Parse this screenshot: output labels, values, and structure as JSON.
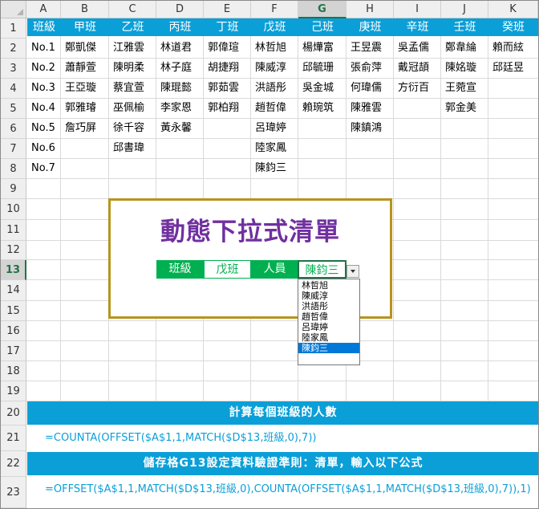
{
  "columns": [
    "A",
    "B",
    "C",
    "D",
    "E",
    "F",
    "G",
    "H",
    "I",
    "J",
    "K"
  ],
  "rows": [
    "1",
    "2",
    "3",
    "4",
    "5",
    "6",
    "7",
    "8",
    "9",
    "10",
    "11",
    "12",
    "13",
    "14",
    "15",
    "16",
    "17",
    "18",
    "19",
    "20",
    "21",
    "22",
    "23"
  ],
  "header": [
    "班級",
    "甲班",
    "乙班",
    "丙班",
    "丁班",
    "戊班",
    "己班",
    "庚班",
    "辛班",
    "壬班",
    "癸班"
  ],
  "data_rows": [
    [
      "No.1",
      "鄭凱傑",
      "江雅雲",
      "林道君",
      "郭偉瑄",
      "林哲旭",
      "楊燁富",
      "王昱震",
      "吳孟儒",
      "鄭韋綸",
      "賴而絃"
    ],
    [
      "No.2",
      "蕭靜萱",
      "陳明柔",
      "林子庭",
      "胡捷翔",
      "陳威淳",
      "邱毓珊",
      "張俞萍",
      "戴冠頡",
      "陳姳璇",
      "邱廷昱"
    ],
    [
      "No.3",
      "王亞璇",
      "蔡宜萱",
      "陳琨懿",
      "郭茹雲",
      "洪語彤",
      "吳金城",
      "何瑋儒",
      "方衍百",
      "王菀宣",
      ""
    ],
    [
      "No.4",
      "郭雅璿",
      "巫佩榆",
      "李家恩",
      "郭柏翔",
      "趙哲偉",
      "賴琬筑",
      "陳雅雲",
      "",
      "郭金美",
      ""
    ],
    [
      "No.5",
      "詹巧屏",
      "徐千容",
      "黃永馨",
      "",
      "呂瑋婷",
      "",
      "陳鎮鴻",
      "",
      "",
      ""
    ],
    [
      "No.6",
      "",
      "邱書瑋",
      "",
      "",
      "陸家鳳",
      "",
      "",
      "",
      "",
      ""
    ],
    [
      "No.7",
      "",
      "",
      "",
      "",
      "陳鈞三",
      "",
      "",
      "",
      "",
      ""
    ]
  ],
  "panel": {
    "title": "動態下拉式清單",
    "class_label": "班級",
    "class_value": "戊班",
    "person_label": "人員",
    "person_value": "陳鈞三"
  },
  "dropdown": {
    "items": [
      "林哲旭",
      "陳威淳",
      "洪語彤",
      "趙哲偉",
      "呂瑋婷",
      "陸家鳳",
      "陳鈞三"
    ],
    "selected_index": 6
  },
  "notes": {
    "row20": "計算每個班級的人數",
    "row21": "=COUNTA(OFFSET($A$1,1,MATCH($D$13,班級,0),7))",
    "row22": "儲存格G13設定資料驗證準則：清單，輸入以下公式",
    "row23": "=OFFSET($A$1,1,MATCH($D$13,班級,0),COUNTA(OFFSET($A$1,1,MATCH($D$13,班級,0),7)),1)"
  },
  "colors": {
    "header_bg": "#0b9fd8",
    "title": "#7030a0",
    "control_green": "#00b050",
    "frame_gold": "#b8941f",
    "selection_blue": "#0078d7"
  }
}
